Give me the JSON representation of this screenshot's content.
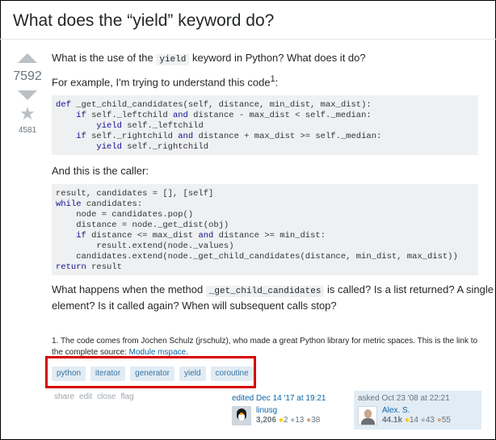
{
  "question": {
    "title": "What does the “yield” keyword do?",
    "votes": "7592",
    "favorites": "4581",
    "p1_before": "What is the use of the ",
    "p1_code": "yield",
    "p1_after": " keyword in Python? What does it do?",
    "p2_text": "For example, I'm trying to understand this code",
    "p2_sup": "1",
    "p2_end": ":",
    "code1": [
      [
        {
          "k": "def"
        },
        {
          "t": " _get_child_candidates(self, distance, min_dist, max_dist):"
        }
      ],
      [
        {
          "t": "    "
        },
        {
          "k": "if"
        },
        {
          "t": " self._leftchild "
        },
        {
          "k": "and"
        },
        {
          "t": " distance - max_dist < self._median:"
        }
      ],
      [
        {
          "t": "        "
        },
        {
          "k": "yield"
        },
        {
          "t": " self._leftchild"
        }
      ],
      [
        {
          "t": "    "
        },
        {
          "k": "if"
        },
        {
          "t": " self._rightchild "
        },
        {
          "k": "and"
        },
        {
          "t": " distance + max_dist >= self._median:"
        }
      ],
      [
        {
          "t": "        "
        },
        {
          "k": "yield"
        },
        {
          "t": " self._rightchild"
        }
      ]
    ],
    "p3": "And this is the caller:",
    "code2": [
      [
        {
          "t": "result, candidates = [], [self]"
        }
      ],
      [
        {
          "k": "while"
        },
        {
          "t": " candidates:"
        }
      ],
      [
        {
          "t": "    node = candidates.pop()"
        }
      ],
      [
        {
          "t": "    distance = node._get_dist(obj)"
        }
      ],
      [
        {
          "t": "    "
        },
        {
          "k": "if"
        },
        {
          "t": " distance <= max_dist "
        },
        {
          "k": "and"
        },
        {
          "t": " distance >= min_dist:"
        }
      ],
      [
        {
          "t": "        result.extend(node._values)"
        }
      ],
      [
        {
          "t": "    candidates.extend(node._get_child_candidates(distance, min_dist, max_dist))"
        }
      ],
      [
        {
          "k": "return"
        },
        {
          "t": " result"
        }
      ]
    ],
    "p4_before": "What happens when the method ",
    "p4_code": "_get_child_candidates",
    "p4_after": " is called? Is a list returned? A single",
    "p4_line2": "element? Is it called again? When will subsequent calls stop?",
    "footnote_text": "1. The code comes from Jochen Schulz (jrschulz), who made a great Python library for metric spaces. This is the link to the complete source: ",
    "footnote_link": "Module mspace",
    "footnote_end": ".",
    "tags": [
      "python",
      "iterator",
      "generator",
      "yield",
      "coroutine"
    ],
    "actions": [
      "share",
      "edit",
      "close",
      "flag"
    ]
  },
  "editor": {
    "when": "edited Dec 14 '17 at 19:21",
    "name": "linusg",
    "rep": "3,206",
    "gold": "2",
    "silver": "13",
    "bronze": "38"
  },
  "asker": {
    "when": "asked Oct 23 '08 at 22:21",
    "name": "Alex. S.",
    "rep": "44.1k",
    "gold": "14",
    "silver": "43",
    "bronze": "55"
  },
  "colors": {
    "tag_bg": "#e1ecf4",
    "tag_fg": "#39739d",
    "highlight": "#d80000",
    "keyword": "#101094"
  }
}
